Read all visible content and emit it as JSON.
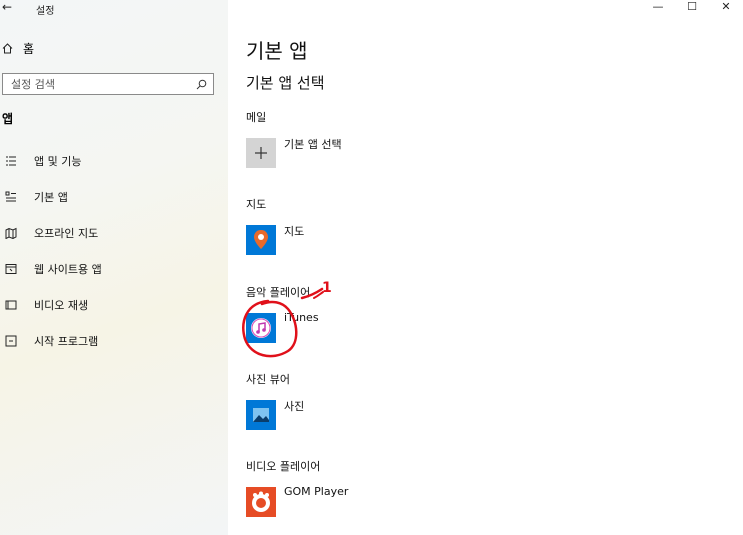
{
  "window": {
    "back_glyph": "←",
    "title": "설정",
    "minimize": "—",
    "maximize": "☐",
    "close": "✕"
  },
  "sidebar": {
    "home_label": "홈",
    "search_placeholder": "설정 검색",
    "section_title": "앱",
    "items": [
      {
        "icon": "apps-features-icon",
        "label": "앱 및 기능"
      },
      {
        "icon": "default-apps-icon",
        "label": "기본 앱"
      },
      {
        "icon": "offline-maps-icon",
        "label": "오프라인 지도"
      },
      {
        "icon": "apps-for-websites-icon",
        "label": "웹 사이트용 앱"
      },
      {
        "icon": "video-playback-icon",
        "label": "비디오 재생"
      },
      {
        "icon": "startup-icon",
        "label": "시작 프로그램"
      }
    ]
  },
  "main": {
    "title": "기본 앱",
    "subtitle": "기본 앱 선택",
    "categories": [
      {
        "label": "메일",
        "app": "기본 앱 선택",
        "icon": "plus-icon",
        "tile_color": "#d4d4d4"
      },
      {
        "label": "지도",
        "app": "지도",
        "icon": "map-pin-icon",
        "tile_color": "#0078d7"
      },
      {
        "label": "음악 플레이어",
        "app": "iTunes",
        "icon": "music-note-icon",
        "tile_color": "#0078d7"
      },
      {
        "label": "사진 뷰어",
        "app": "사진",
        "icon": "photo-icon",
        "tile_color": "#0078d7"
      },
      {
        "label": "비디오 플레이어",
        "app": "GOM Player",
        "icon": "gom-player-icon",
        "tile_color": "#e64c25"
      }
    ]
  },
  "annotation": {
    "number": "1",
    "color": "#e0101a"
  }
}
